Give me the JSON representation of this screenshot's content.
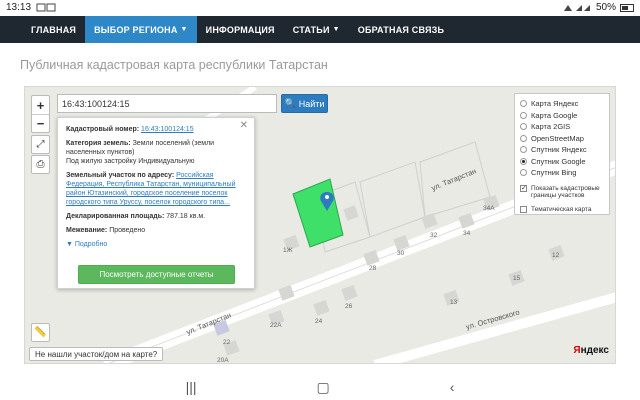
{
  "statusbar": {
    "time": "13:13",
    "battery": "50%"
  },
  "nav": {
    "items": [
      {
        "label": "ГЛАВНАЯ"
      },
      {
        "label": "ВЫБОР РЕГИОНА"
      },
      {
        "label": "ИНФОРМАЦИЯ"
      },
      {
        "label": "СТАТЬИ"
      },
      {
        "label": "ОБРАТНАЯ СВЯЗЬ"
      }
    ]
  },
  "page": {
    "title": "Публичная кадастровая карта республики Татарстан"
  },
  "search": {
    "value": "16:43:100124:15",
    "button_label": "Найти"
  },
  "popup": {
    "cad_label": "Кадастровый номер:",
    "cad_value": "16:43:100124:15",
    "category_label": "Категория земель:",
    "category_value": "Земли поселений (земли населенных пунктов)",
    "use_value": "Под жилую застройку Индивидуальную",
    "address_label": "Земельный участок по адресу:",
    "address_value": "Российская Федерация, Республика Татарстан, муниципальный район Ютазинский, городское поселение поселок городского типа Уруссу, поселок городского типа...",
    "area_label": "Декларированная площадь:",
    "area_value": "787.18 кв.м.",
    "survey_label": "Межевание:",
    "survey_value": "Проведено",
    "more": "Подробно",
    "report_button": "Посмотреть доступные отчеты"
  },
  "layers": {
    "options": [
      {
        "label": "Карта Яндекс"
      },
      {
        "label": "Карта Google"
      },
      {
        "label": "Карта 2GIS"
      },
      {
        "label": "OpenStreetMap"
      },
      {
        "label": "Спутник Яндекс"
      },
      {
        "label": "Спутник Google"
      },
      {
        "label": "Спутник Bing"
      }
    ],
    "checks": [
      {
        "label": "Показать кадастровые границы участков",
        "checked": true
      },
      {
        "label": "Тематическая карта",
        "checked": false
      }
    ]
  },
  "map": {
    "street1": "ул. Татарстан",
    "street2": "ул. Татарстан",
    "street3": "ул. Островского",
    "houses": [
      "34А",
      "32",
      "34",
      "30",
      "28",
      "1Ж",
      "26",
      "24",
      "22А",
      "22",
      "20А",
      "12",
      "15",
      "13"
    ],
    "not_found": "Не нашли участок/дом на карте?",
    "brand_y": "Я",
    "brand_rest": "ндекс"
  },
  "colors": {
    "nav_bg": "#1f2730",
    "nav_active": "#2e88c8",
    "parcel": "#3ee06a",
    "report_btn": "#5cb85c"
  }
}
